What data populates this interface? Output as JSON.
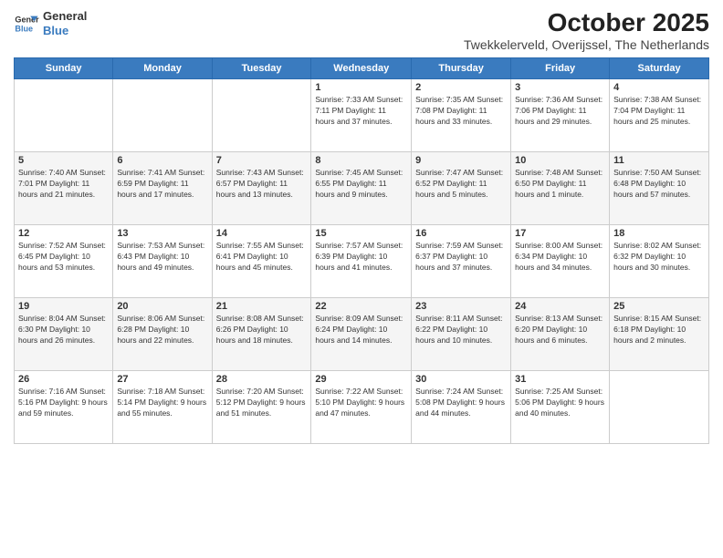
{
  "logo": {
    "line1": "General",
    "line2": "Blue"
  },
  "title": "October 2025",
  "subtitle": "Twekkelerveld, Overijssel, The Netherlands",
  "days_of_week": [
    "Sunday",
    "Monday",
    "Tuesday",
    "Wednesday",
    "Thursday",
    "Friday",
    "Saturday"
  ],
  "weeks": [
    [
      {
        "day": "",
        "info": ""
      },
      {
        "day": "",
        "info": ""
      },
      {
        "day": "",
        "info": ""
      },
      {
        "day": "1",
        "info": "Sunrise: 7:33 AM\nSunset: 7:11 PM\nDaylight: 11 hours\nand 37 minutes."
      },
      {
        "day": "2",
        "info": "Sunrise: 7:35 AM\nSunset: 7:08 PM\nDaylight: 11 hours\nand 33 minutes."
      },
      {
        "day": "3",
        "info": "Sunrise: 7:36 AM\nSunset: 7:06 PM\nDaylight: 11 hours\nand 29 minutes."
      },
      {
        "day": "4",
        "info": "Sunrise: 7:38 AM\nSunset: 7:04 PM\nDaylight: 11 hours\nand 25 minutes."
      }
    ],
    [
      {
        "day": "5",
        "info": "Sunrise: 7:40 AM\nSunset: 7:01 PM\nDaylight: 11 hours\nand 21 minutes."
      },
      {
        "day": "6",
        "info": "Sunrise: 7:41 AM\nSunset: 6:59 PM\nDaylight: 11 hours\nand 17 minutes."
      },
      {
        "day": "7",
        "info": "Sunrise: 7:43 AM\nSunset: 6:57 PM\nDaylight: 11 hours\nand 13 minutes."
      },
      {
        "day": "8",
        "info": "Sunrise: 7:45 AM\nSunset: 6:55 PM\nDaylight: 11 hours\nand 9 minutes."
      },
      {
        "day": "9",
        "info": "Sunrise: 7:47 AM\nSunset: 6:52 PM\nDaylight: 11 hours\nand 5 minutes."
      },
      {
        "day": "10",
        "info": "Sunrise: 7:48 AM\nSunset: 6:50 PM\nDaylight: 11 hours\nand 1 minute."
      },
      {
        "day": "11",
        "info": "Sunrise: 7:50 AM\nSunset: 6:48 PM\nDaylight: 10 hours\nand 57 minutes."
      }
    ],
    [
      {
        "day": "12",
        "info": "Sunrise: 7:52 AM\nSunset: 6:45 PM\nDaylight: 10 hours\nand 53 minutes."
      },
      {
        "day": "13",
        "info": "Sunrise: 7:53 AM\nSunset: 6:43 PM\nDaylight: 10 hours\nand 49 minutes."
      },
      {
        "day": "14",
        "info": "Sunrise: 7:55 AM\nSunset: 6:41 PM\nDaylight: 10 hours\nand 45 minutes."
      },
      {
        "day": "15",
        "info": "Sunrise: 7:57 AM\nSunset: 6:39 PM\nDaylight: 10 hours\nand 41 minutes."
      },
      {
        "day": "16",
        "info": "Sunrise: 7:59 AM\nSunset: 6:37 PM\nDaylight: 10 hours\nand 37 minutes."
      },
      {
        "day": "17",
        "info": "Sunrise: 8:00 AM\nSunset: 6:34 PM\nDaylight: 10 hours\nand 34 minutes."
      },
      {
        "day": "18",
        "info": "Sunrise: 8:02 AM\nSunset: 6:32 PM\nDaylight: 10 hours\nand 30 minutes."
      }
    ],
    [
      {
        "day": "19",
        "info": "Sunrise: 8:04 AM\nSunset: 6:30 PM\nDaylight: 10 hours\nand 26 minutes."
      },
      {
        "day": "20",
        "info": "Sunrise: 8:06 AM\nSunset: 6:28 PM\nDaylight: 10 hours\nand 22 minutes."
      },
      {
        "day": "21",
        "info": "Sunrise: 8:08 AM\nSunset: 6:26 PM\nDaylight: 10 hours\nand 18 minutes."
      },
      {
        "day": "22",
        "info": "Sunrise: 8:09 AM\nSunset: 6:24 PM\nDaylight: 10 hours\nand 14 minutes."
      },
      {
        "day": "23",
        "info": "Sunrise: 8:11 AM\nSunset: 6:22 PM\nDaylight: 10 hours\nand 10 minutes."
      },
      {
        "day": "24",
        "info": "Sunrise: 8:13 AM\nSunset: 6:20 PM\nDaylight: 10 hours\nand 6 minutes."
      },
      {
        "day": "25",
        "info": "Sunrise: 8:15 AM\nSunset: 6:18 PM\nDaylight: 10 hours\nand 2 minutes."
      }
    ],
    [
      {
        "day": "26",
        "info": "Sunrise: 7:16 AM\nSunset: 5:16 PM\nDaylight: 9 hours\nand 59 minutes."
      },
      {
        "day": "27",
        "info": "Sunrise: 7:18 AM\nSunset: 5:14 PM\nDaylight: 9 hours\nand 55 minutes."
      },
      {
        "day": "28",
        "info": "Sunrise: 7:20 AM\nSunset: 5:12 PM\nDaylight: 9 hours\nand 51 minutes."
      },
      {
        "day": "29",
        "info": "Sunrise: 7:22 AM\nSunset: 5:10 PM\nDaylight: 9 hours\nand 47 minutes."
      },
      {
        "day": "30",
        "info": "Sunrise: 7:24 AM\nSunset: 5:08 PM\nDaylight: 9 hours\nand 44 minutes."
      },
      {
        "day": "31",
        "info": "Sunrise: 7:25 AM\nSunset: 5:06 PM\nDaylight: 9 hours\nand 40 minutes."
      },
      {
        "day": "",
        "info": ""
      }
    ]
  ]
}
